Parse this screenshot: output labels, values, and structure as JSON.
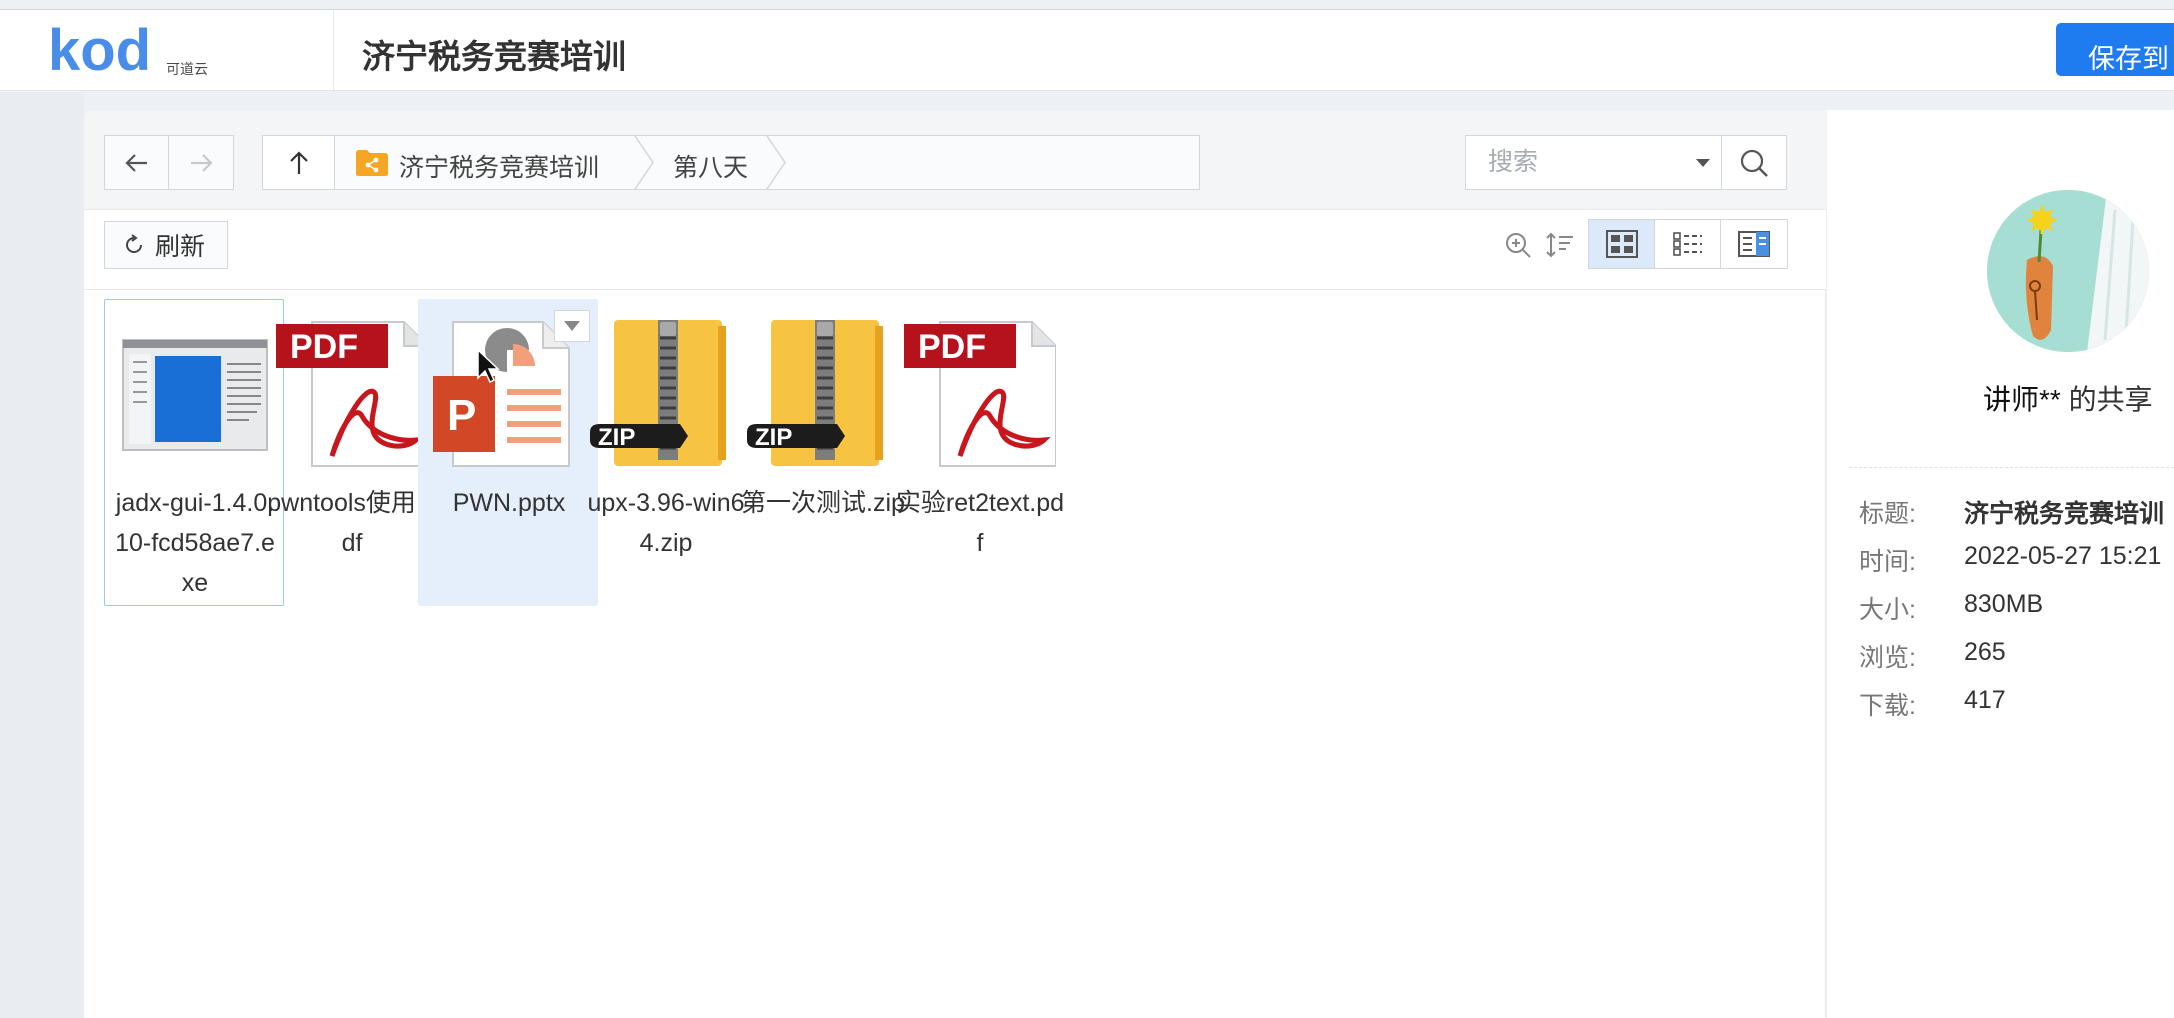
{
  "header": {
    "logo_text": "kod",
    "logo_subtext": "可道云",
    "share_title": "济宁税务竞赛培训",
    "save_button": "保存到"
  },
  "toolbar": {
    "breadcrumbs": [
      "济宁税务竞赛培训",
      "第八天"
    ],
    "search_placeholder": "搜索",
    "refresh_label": "刷新"
  },
  "files": [
    {
      "name": "jadx-gui-1.4.0.10-fcd58ae7.exe",
      "type": "exe",
      "state": "selected"
    },
    {
      "name": "pwntools使用.pdf",
      "type": "pdf",
      "state": "normal"
    },
    {
      "name": "PWN.pptx",
      "type": "pptx",
      "state": "hover"
    },
    {
      "name": "upx-3.96-win64.zip",
      "type": "zip",
      "state": "normal"
    },
    {
      "name": "第一次测试.zip",
      "type": "zip",
      "state": "normal"
    },
    {
      "name": "实验ret2text.pdf",
      "type": "pdf",
      "state": "normal"
    }
  ],
  "sidebar": {
    "sharer_name": "讲师**",
    "sharer_suffix": " 的共享",
    "info": [
      {
        "label": "标题:",
        "value": "济宁税务竞赛培训"
      },
      {
        "label": "时间:",
        "value": "2022-05-27 15:21"
      },
      {
        "label": "大小:",
        "value": "830MB"
      },
      {
        "label": "浏览:",
        "value": "265"
      },
      {
        "label": "下载:",
        "value": "417"
      }
    ]
  },
  "icons": {
    "back": "arrow-left-icon",
    "forward": "arrow-right-icon",
    "up": "arrow-up-icon",
    "folder": "shared-folder-icon",
    "search": "search-icon",
    "refresh": "refresh-icon",
    "zoom": "zoom-icon",
    "sort": "sort-icon",
    "view_icon": "grid-view-icon",
    "view_list": "list-view-icon",
    "view_split": "split-view-icon"
  },
  "colors": {
    "accent": "#1f7bf0",
    "selected_bg": "#dbe9fb",
    "pdf_red": "#b6121b",
    "zip_yellow": "#f7c343",
    "ppt_orange": "#d24726"
  }
}
